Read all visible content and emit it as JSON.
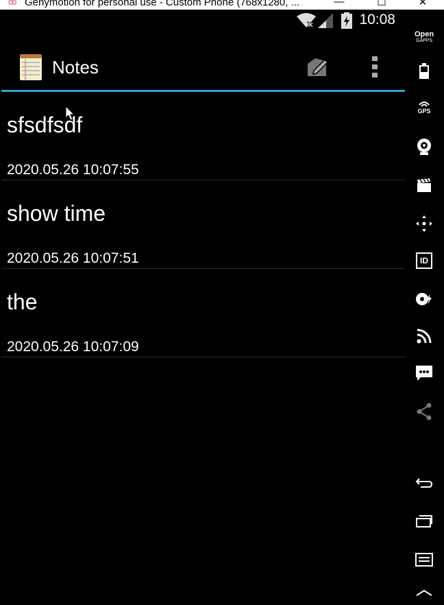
{
  "window": {
    "title": "Genymotion for personal use - Custom Phone (768x1280, ...",
    "logo": "oo",
    "minimize": "—",
    "maximize": "☐",
    "close": "✕"
  },
  "status_bar": {
    "time": "10:08"
  },
  "action_bar": {
    "app_title": "Notes",
    "accent_color": "#3aa4cf"
  },
  "notes": [
    {
      "title": "sfsdfsdf",
      "date": "2020.05.26 10:07:55"
    },
    {
      "title": "show time",
      "date": "2020.05.26 10:07:51"
    },
    {
      "title": "the",
      "date": "2020.05.26 10:07:09"
    }
  ],
  "sidebar": {
    "opengapps_line1": "Open",
    "opengapps_line2": "GAPPS",
    "gps_label": "GPS",
    "id_label": "ID",
    "icons": [
      "open-gapps-icon",
      "battery-icon",
      "gps-icon",
      "webcam-icon",
      "capture-icon",
      "dpad-icon",
      "device-id-icon",
      "disk-icon",
      "network-icon",
      "sms-icon",
      "share-icon",
      "back-icon",
      "recent-apps-icon",
      "menu-icon"
    ]
  }
}
